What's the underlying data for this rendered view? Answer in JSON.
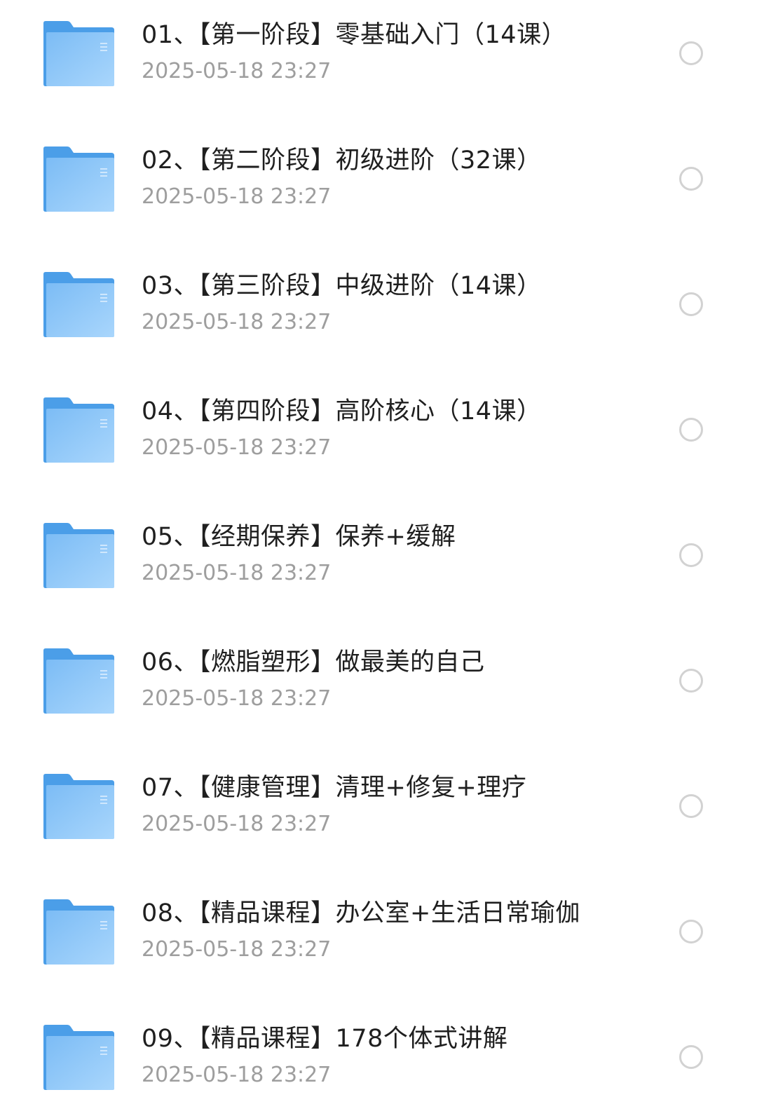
{
  "accent": {
    "folder": "#5aa8ec",
    "folder_light": "#9fd0fb"
  },
  "items": [
    {
      "title": "01、【第一阶段】零基础入门（14课）",
      "date": "2025-05-18 23:27"
    },
    {
      "title": "02、【第二阶段】初级进阶（32课）",
      "date": "2025-05-18 23:27"
    },
    {
      "title": "03、【第三阶段】中级进阶（14课）",
      "date": "2025-05-18 23:27"
    },
    {
      "title": "04、【第四阶段】高阶核心（14课）",
      "date": "2025-05-18 23:27"
    },
    {
      "title": "05、【经期保养】保养+缓解",
      "date": "2025-05-18 23:27"
    },
    {
      "title": "06、【燃脂塑形】做最美的自己",
      "date": "2025-05-18 23:27"
    },
    {
      "title": "07、【健康管理】清理+修复+理疗",
      "date": "2025-05-18 23:27"
    },
    {
      "title": "08、【精品课程】办公室+生活日常瑜伽",
      "date": "2025-05-18 23:27"
    },
    {
      "title": "09、【精品课程】178个体式讲解",
      "date": "2025-05-18 23:27"
    }
  ]
}
